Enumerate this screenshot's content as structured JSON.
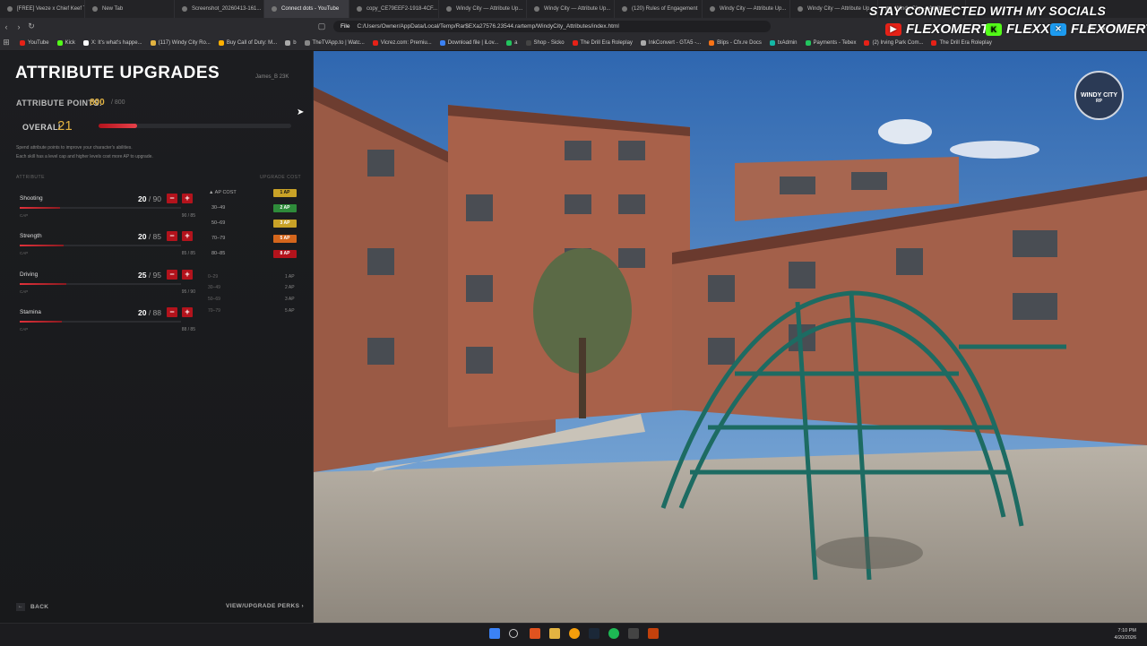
{
  "browser": {
    "tabs": [
      {
        "label": "[FREE] Veeze x Chief Keef T..."
      },
      {
        "label": "New Tab"
      },
      {
        "label": "Screenshot_20260413-161..."
      },
      {
        "label": "Connect dots - YouTube"
      },
      {
        "label": "copy_CE79EEF2-1918-4CF..."
      },
      {
        "label": "Windy City — Attribute Up..."
      },
      {
        "label": "Windy City — Attribute Up..."
      },
      {
        "label": "(120) Rules of Engagement"
      },
      {
        "label": "Windy City — Attribute Up..."
      },
      {
        "label": "Windy City — Attribute Up..."
      },
      {
        "label": "Windy City — Attribute Up..."
      }
    ],
    "url_scheme": "File",
    "url": "C:/Users/Owner/AppData/Local/Temp/Rar$EXa27576.23544.rartemp/WindyCity_Attributes/index.html",
    "bookmarks": [
      {
        "label": "YouTube",
        "color": "#e62117"
      },
      {
        "label": "Kick",
        "color": "#53fc18"
      },
      {
        "label": "X: It's what's happe...",
        "color": "#ffffff"
      },
      {
        "label": "(117) Windy City Ro...",
        "color": "#e3b341"
      },
      {
        "label": "Buy Call of Duty: M...",
        "color": "#ffb000"
      },
      {
        "label": "b",
        "color": "#aaaaaa"
      },
      {
        "label": "TheTVApp.to | Watc...",
        "color": "#888888"
      },
      {
        "label": "Vicrez.com: Premiu...",
        "color": "#e62117"
      },
      {
        "label": "Download file | iLov...",
        "color": "#3b82f6"
      },
      {
        "label": "a",
        "color": "#22c55e"
      },
      {
        "label": "Shop - Sicko",
        "color": "#444444"
      },
      {
        "label": "The Drill Era Roleplay",
        "color": "#e62117"
      },
      {
        "label": "InkConvert - GTA5 -...",
        "color": "#aaaaaa"
      },
      {
        "label": "Blips - Cfx.re Docs",
        "color": "#f97316"
      },
      {
        "label": "txAdmin",
        "color": "#14b8a6"
      },
      {
        "label": "Payments - Tebex",
        "color": "#22c55e"
      },
      {
        "label": "(2) Irving Park Com...",
        "color": "#e62117"
      },
      {
        "label": "The Drill Era Roleplay",
        "color": "#e62117"
      }
    ]
  },
  "social": {
    "title": "STAY CONNECTED WITH MY SOCIALS",
    "items": [
      {
        "handle": "FLEXOMERTA",
        "platform_icon": "youtube-icon",
        "color": "#e62117"
      },
      {
        "handle": "FLEXX",
        "platform_icon": "kick-icon",
        "color": "#53fc18"
      },
      {
        "handle": "FLEXOMERTA",
        "platform_icon": "x-icon",
        "color": "#1d9bf0"
      }
    ]
  },
  "panel": {
    "title": "ATTRIBUTE UPGRADES",
    "user": "James_B   23K",
    "ap_label": "ATTRIBUTE POINTS:",
    "ap_current": "800",
    "ap_max": "/ 800",
    "overall_label": "OVERALL",
    "overall_value": "21",
    "overall_progress": 0.2,
    "description_1": "Spend attribute points to improve your character's abilities.",
    "description_2": "Each skill has a level cap and higher levels cost more AP to upgrade.",
    "col_attributes": "ATTRIBUTE",
    "col_upgrade_cost": "UPGRADE COST",
    "skills": [
      {
        "name": "Shooting",
        "value": "20",
        "max": "/ 90",
        "range": "90 / 85",
        "cap": "CAP",
        "progress": 0.25
      },
      {
        "name": "Strength",
        "value": "20",
        "max": "/ 85",
        "range": "85 / 85",
        "cap": "CAP",
        "progress": 0.27
      },
      {
        "name": "Driving",
        "value": "25",
        "max": "/ 95",
        "range": "95 / 90",
        "cap": "CAP",
        "progress": 0.29
      },
      {
        "name": "Stamina",
        "value": "20",
        "max": "/ 88",
        "range": "88 / 85",
        "cap": "CAP",
        "progress": 0.26
      }
    ],
    "cost_header": "AP COST",
    "cost_table": [
      {
        "range": "30–49",
        "badge": "2 AP",
        "color": "#2e8b3a"
      },
      {
        "range": "50–69",
        "badge": "3 AP",
        "color": "#c9a227"
      },
      {
        "range": "70–79",
        "badge": "5 AP",
        "color": "#d4661c"
      },
      {
        "range": "80–85",
        "badge": "8 AP",
        "color": "#b3131c"
      }
    ],
    "cost_header_badge": {
      "badge": "1 AP",
      "color": "#c9a227"
    },
    "reference": [
      {
        "range": "0–29",
        "ap": "1 AP"
      },
      {
        "range": "30–49",
        "ap": "2 AP"
      },
      {
        "range": "50–69",
        "ap": "3 AP"
      },
      {
        "range": "70–79",
        "ap": "5 AP"
      }
    ],
    "back_label": "BACK",
    "perks_label": "VIEW/UPGRADE PERKS ›"
  },
  "badge": {
    "line1": "WINDY CITY",
    "line2": "RP"
  },
  "clock": {
    "time": "7:10 PM",
    "date": "4/20/2026"
  }
}
